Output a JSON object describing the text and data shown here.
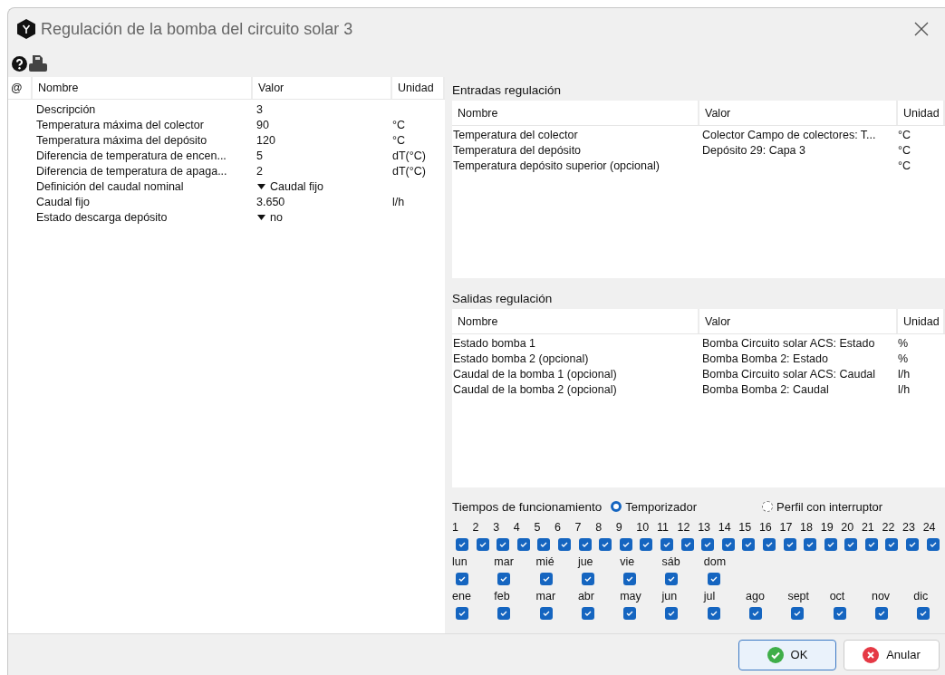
{
  "window": {
    "title": "Regulación de la bomba del circuito solar 3"
  },
  "parameters": {
    "columns": [
      "@",
      "Nombre",
      "Valor",
      "Unidad"
    ],
    "rows": [
      {
        "name": "Descripción",
        "value": "3",
        "unit": "",
        "kind": "text"
      },
      {
        "name": "Temperatura máxima del colector",
        "value": "90",
        "unit": "°C",
        "kind": "text"
      },
      {
        "name": "Temperatura máxima del depósito",
        "value": "120",
        "unit": "°C",
        "kind": "text"
      },
      {
        "name": "Diferencia de temperatura de encen...",
        "value": "5",
        "unit": "dT(°C)",
        "kind": "text"
      },
      {
        "name": "Diferencia de temperatura de apaga...",
        "value": "2",
        "unit": "dT(°C)",
        "kind": "text"
      },
      {
        "name": "Definición del caudal nominal",
        "value": "Caudal fijo",
        "unit": "",
        "kind": "dropdown"
      },
      {
        "name": "Caudal fijo",
        "value": "3.650",
        "unit": "l/h",
        "kind": "text"
      },
      {
        "name": "Estado descarga depósito",
        "value": "no",
        "unit": "",
        "kind": "dropdown"
      }
    ]
  },
  "inputs": {
    "title": "Entradas regulación",
    "columns": [
      "Nombre",
      "Valor",
      "Unidad"
    ],
    "rows": [
      {
        "name": "Temperatura del colector",
        "value": "Colector Campo de colectores: T...",
        "unit": "°C"
      },
      {
        "name": "Temperatura del depósito",
        "value": "Depósito 29: Capa 3",
        "unit": "°C"
      },
      {
        "name": "Temperatura depósito superior (opcional)",
        "value": "",
        "unit": "°C"
      }
    ]
  },
  "outputs": {
    "title": "Salidas regulación",
    "columns": [
      "Nombre",
      "Valor",
      "Unidad"
    ],
    "rows": [
      {
        "name": "Estado bomba 1",
        "value": "Bomba Circuito solar ACS: Estado",
        "unit": "%"
      },
      {
        "name": "Estado bomba 2 (opcional)",
        "value": "Bomba Bomba 2: Estado",
        "unit": "%"
      },
      {
        "name": "Caudal de la bomba 1 (opcional)",
        "value": "Bomba Circuito solar ACS: Caudal",
        "unit": "l/h"
      },
      {
        "name": "Caudal de la bomba 2 (opcional)",
        "value": "Bomba Bomba 2: Caudal",
        "unit": "l/h"
      }
    ]
  },
  "schedule": {
    "title": "Tiempos de funcionamiento",
    "modes": [
      {
        "label": "Temporizador",
        "selected": true
      },
      {
        "label": "Perfil con interruptor",
        "selected": false
      }
    ],
    "hours": [
      {
        "label": "1",
        "checked": true
      },
      {
        "label": "2",
        "checked": true
      },
      {
        "label": "3",
        "checked": true
      },
      {
        "label": "4",
        "checked": true
      },
      {
        "label": "5",
        "checked": true
      },
      {
        "label": "6",
        "checked": true
      },
      {
        "label": "7",
        "checked": true
      },
      {
        "label": "8",
        "checked": true
      },
      {
        "label": "9",
        "checked": true
      },
      {
        "label": "10",
        "checked": true
      },
      {
        "label": "11",
        "checked": true
      },
      {
        "label": "12",
        "checked": true
      },
      {
        "label": "13",
        "checked": true
      },
      {
        "label": "14",
        "checked": true
      },
      {
        "label": "15",
        "checked": true
      },
      {
        "label": "16",
        "checked": true
      },
      {
        "label": "17",
        "checked": true
      },
      {
        "label": "18",
        "checked": true
      },
      {
        "label": "19",
        "checked": true
      },
      {
        "label": "20",
        "checked": true
      },
      {
        "label": "21",
        "checked": true
      },
      {
        "label": "22",
        "checked": true
      },
      {
        "label": "23",
        "checked": true
      },
      {
        "label": "24",
        "checked": true
      }
    ],
    "days": [
      {
        "label": "lun",
        "checked": true
      },
      {
        "label": "mar",
        "checked": true
      },
      {
        "label": "mié",
        "checked": true
      },
      {
        "label": "jue",
        "checked": true
      },
      {
        "label": "vie",
        "checked": true
      },
      {
        "label": "sáb",
        "checked": true
      },
      {
        "label": "dom",
        "checked": true
      }
    ],
    "months": [
      {
        "label": "ene",
        "checked": true
      },
      {
        "label": "feb",
        "checked": true
      },
      {
        "label": "mar",
        "checked": true
      },
      {
        "label": "abr",
        "checked": true
      },
      {
        "label": "may",
        "checked": true
      },
      {
        "label": "jun",
        "checked": true
      },
      {
        "label": "jul",
        "checked": true
      },
      {
        "label": "ago",
        "checked": true
      },
      {
        "label": "sept",
        "checked": true
      },
      {
        "label": "oct",
        "checked": true
      },
      {
        "label": "nov",
        "checked": true
      },
      {
        "label": "dic",
        "checked": true
      }
    ]
  },
  "buttons": [
    {
      "label": "OK",
      "kind": "ok"
    },
    {
      "label": "Anular",
      "kind": "cancel"
    }
  ]
}
